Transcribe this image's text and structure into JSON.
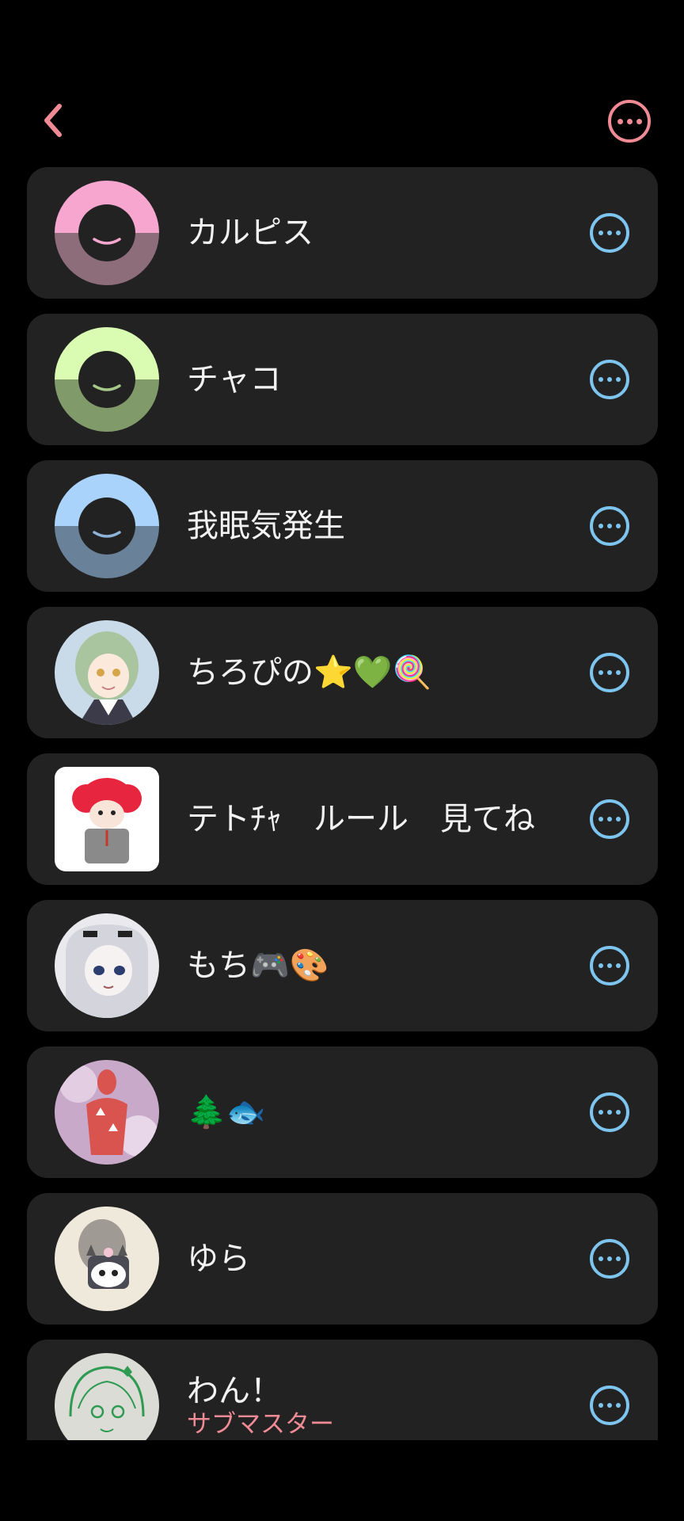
{
  "header": {
    "back_icon": "chevron-left-icon",
    "menu_icon": "more-horizontal-icon",
    "accent_color": "#f08b95"
  },
  "members": [
    {
      "name": "カルピス",
      "avatar": "default-pink",
      "role": ""
    },
    {
      "name": "チャコ",
      "avatar": "default-green",
      "role": ""
    },
    {
      "name": "我眠気発生",
      "avatar": "default-blue",
      "role": ""
    },
    {
      "name": "ちろぴの⭐💚🍭",
      "avatar": "anime-girl-green-hair",
      "role": ""
    },
    {
      "name": "テトﾁｬ　ルール　見てね",
      "avatar": "red-hair-sketch",
      "role": ""
    },
    {
      "name": "もち🎮🎨",
      "avatar": "white-hair-hood",
      "role": ""
    },
    {
      "name": "🌲🐟",
      "avatar": "red-figure-sparkle",
      "role": ""
    },
    {
      "name": "ゆら",
      "avatar": "photo-with-character-sticker",
      "role": ""
    },
    {
      "name": "わん！",
      "avatar": "green-line-sketch",
      "role": "サブマスター"
    }
  ],
  "colors": {
    "row_background": "#222222",
    "more_button": "#7dc4ee",
    "role_text": "#f08b95"
  }
}
